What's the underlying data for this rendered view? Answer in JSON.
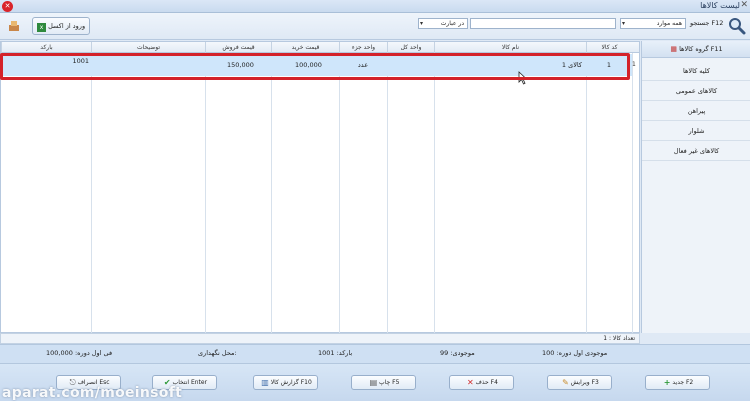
{
  "window": {
    "title": "لیست کالاها",
    "close_glyph": "✕"
  },
  "toolbar": {
    "search_label": "جستجو F12",
    "scope_value": "همه موارد",
    "in_value": "در عبارت",
    "search_value": "",
    "import_label": "ورود از اکسل"
  },
  "grid": {
    "columns": [
      "کد کالا",
      "نام کالا",
      "واحد کل",
      "واحد جزء",
      "قیمت خرید",
      "قیمت فروش",
      "توضیحات",
      "بارکد"
    ],
    "rows": [
      {
        "code": "1",
        "name": "کالای 1",
        "unit_main": "",
        "unit_sub": "عدد",
        "buy": "100,000",
        "sell": "150,000",
        "desc": "",
        "barcode": "1001",
        "marker": "1"
      }
    ]
  },
  "sidebar": {
    "header": "گروه کالاها F11",
    "items": [
      "کلیه کالاها",
      "کالاهای عمومی",
      "پیراهن",
      "شلوار",
      "کالاهای غیر فعال"
    ]
  },
  "status": {
    "count": "تعداد کالا : 1",
    "opening_qty": "موجودی اول دوره: 100",
    "stock": "موجودی: 99",
    "barcode": "بارکد: 1001",
    "warehouse": "محل نگهداری:",
    "opening_price": "فی اول دوره: 100,000"
  },
  "buttons": {
    "new": "جدید F2",
    "edit": "ویرایش F3",
    "delete": "حذف F4",
    "print": "چاپ F5",
    "report": "گزارش کالا F10",
    "select": "انتخاب Enter",
    "cancel": "انصراف Esc"
  },
  "watermark": "aparat.com/moeinsoft",
  "colors": {
    "selection": "#cfe6fb",
    "highlight_frame": "#d4222a",
    "accent": "#2a3f5e"
  }
}
